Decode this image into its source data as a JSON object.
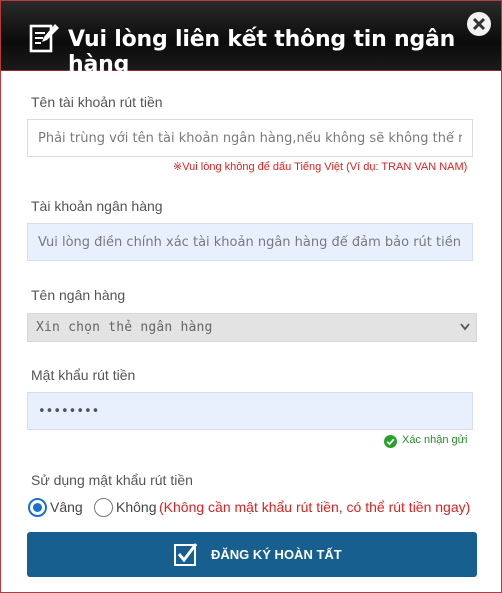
{
  "dialog": {
    "title": "Vui lòng liên kết thông tin ngân hàng",
    "title_icon": "edit-note-icon",
    "close_icon": "close-icon"
  },
  "account_name": {
    "label": "Tên tài khoản rút tiền",
    "placeholder": "Phải trùng với tên tài khoản ngân hàng,nếu không sẽ không thể rút tiền",
    "hint": "※Vui lòng không để dấu Tiếng Việt (Ví dụ: TRAN VAN NAM)"
  },
  "bank_account": {
    "label": "Tài khoản ngân hàng",
    "placeholder": "Vui lòng điền chính xác tài khoản ngân hàng để đảm bảo rút tiền nhanh chóng"
  },
  "bank_name": {
    "label": "Tên ngân hàng",
    "selected": "Xin chọn thẻ ngân hàng"
  },
  "withdraw_password": {
    "label": "Mật khẩu rút tiền",
    "value": "••••••••",
    "status": "Xác nhận gửi"
  },
  "use_password": {
    "label": "Sử dụng mật khẩu rút tiền",
    "yes_label": "Vâng",
    "no_label": "Không",
    "no_note": "(Không cần mật khẩu rút tiền, có thể rút tiền ngay)",
    "selected": "Vâng"
  },
  "submit": {
    "label": "ĐĂNG KÝ HOÀN TẤT"
  },
  "colors": {
    "header_bg": "#111111",
    "accent": "#165f8f",
    "error": "#e02020",
    "success": "#2a8a2a",
    "radio": "#1a6fd1"
  }
}
